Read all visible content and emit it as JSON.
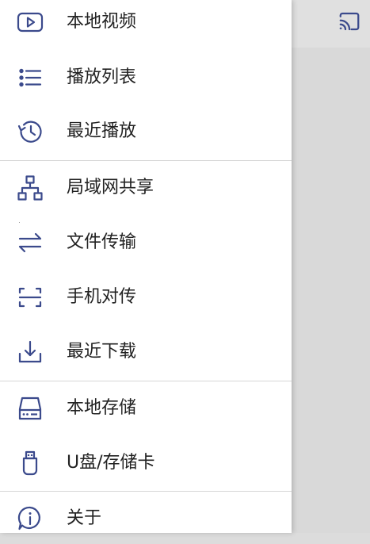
{
  "colors": {
    "icon": "#3b4a8c",
    "label": "#222222",
    "divider": "#d6d6d6",
    "drawer_bg": "#ffffff",
    "backdrop": "#d9d9d9"
  },
  "toolbar": {
    "cast_icon": "cast-icon"
  },
  "drawer": {
    "items": [
      {
        "label": "本地视频",
        "icon": "play-video-icon"
      },
      {
        "label": "播放列表",
        "icon": "list-icon"
      },
      {
        "label": "最近播放",
        "icon": "history-icon"
      },
      {
        "label": "局域网共享",
        "icon": "network-tree-icon"
      },
      {
        "label": "文件传输",
        "icon": "transfer-arrows-icon"
      },
      {
        "label": "手机对传",
        "icon": "scan-frame-icon"
      },
      {
        "label": "最近下载",
        "icon": "download-icon"
      },
      {
        "label": "本地存储",
        "icon": "hard-drive-icon"
      },
      {
        "label": "U盘/存储卡",
        "icon": "usb-drive-icon"
      },
      {
        "label": "关于",
        "icon": "info-chat-icon"
      }
    ]
  }
}
